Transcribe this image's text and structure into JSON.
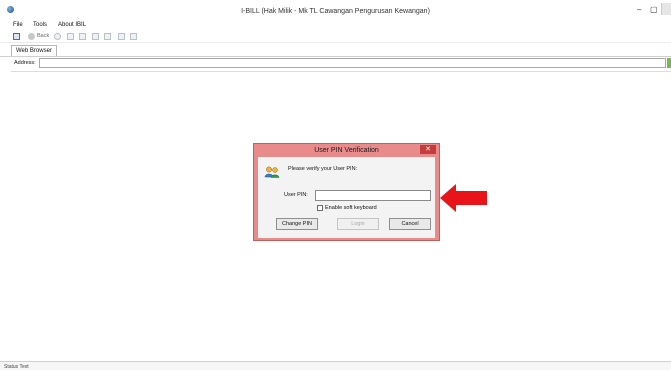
{
  "window": {
    "title": "I-BILL  (Hak Milik - Mk TL Cawangan Pengurusan Kewangan)",
    "min_glyph": "–",
    "max_glyph": "▢"
  },
  "menu": {
    "file": "File",
    "tools": "Tools",
    "about": "About IBIL"
  },
  "toolbar": {
    "back_label": "Back"
  },
  "tab": {
    "label": "Web Browser"
  },
  "address": {
    "label": "Address:",
    "value": ""
  },
  "dialog": {
    "title": "User PIN Verification",
    "close_glyph": "✕",
    "prompt": "Please verify your User PIN:",
    "pin_label": "User PIN:",
    "pin_value": "",
    "soft_keyboard_label": "Enable soft keyboard",
    "buttons": {
      "change_pin": "Change PIN",
      "login": "Login",
      "cancel": "Cancel"
    }
  },
  "status": {
    "text": "Status Text"
  },
  "colors": {
    "dialog_frame": "#e98b8b",
    "close_button": "#c53c3c",
    "arrow": "#e8141a"
  },
  "icons": {
    "app": "app-globe-icon",
    "dialog": "users-icon",
    "annotation": "red-arrow-left-icon"
  }
}
